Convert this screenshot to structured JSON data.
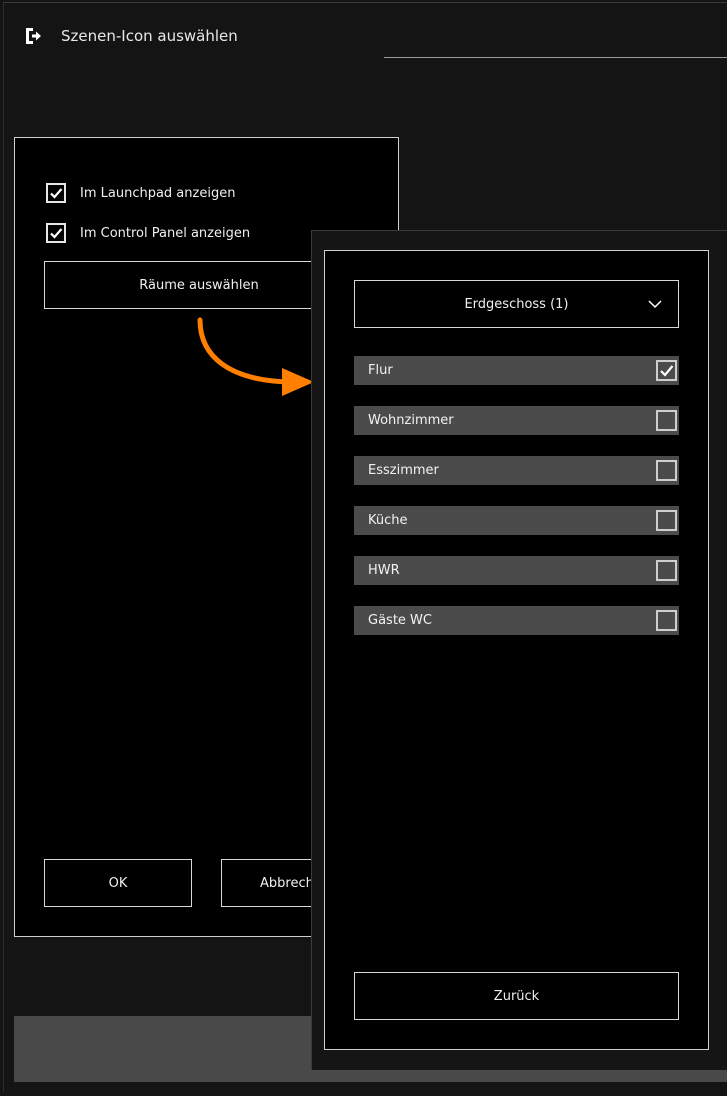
{
  "window": {
    "title": "Szenen-Icon auswählen",
    "exit_icon": "exit-icon"
  },
  "dialog": {
    "checkbox_launchpad": {
      "label": "Im Launchpad anzeigen",
      "checked": true
    },
    "checkbox_control_panel": {
      "label": "Im Control Panel anzeigen",
      "checked": true
    },
    "select_rooms_label": "Räume auswählen",
    "ok_label": "OK",
    "cancel_label": "Abbrechen"
  },
  "annotation": {
    "arrow_color": "#ff7f00",
    "arrow_icon": "curved-arrow-right-icon"
  },
  "room_panel": {
    "floor_select": {
      "value": "Erdgeschoss (1)"
    },
    "rooms": [
      {
        "label": "Flur",
        "checked": true
      },
      {
        "label": "Wohnzimmer",
        "checked": false
      },
      {
        "label": "Esszimmer",
        "checked": false
      },
      {
        "label": "Küche",
        "checked": false
      },
      {
        "label": "HWR",
        "checked": false
      },
      {
        "label": "Gäste WC",
        "checked": false
      }
    ],
    "back_label": "Zurück"
  },
  "colors": {
    "background": "#141414",
    "dialog": "#000000",
    "room_row": "#4b4b4b",
    "accent": "#ff7f00"
  }
}
